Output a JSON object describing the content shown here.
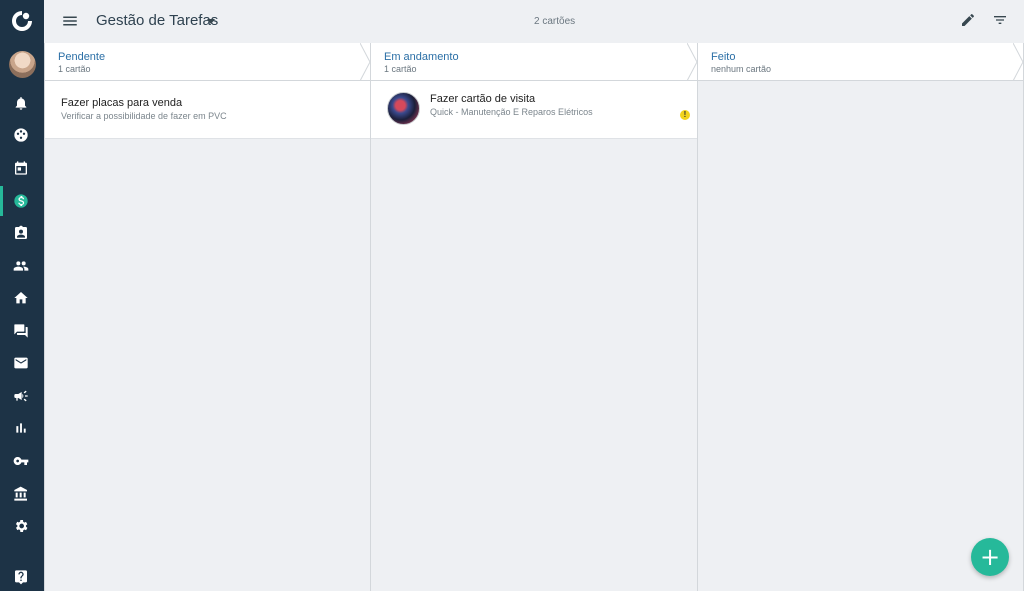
{
  "topbar": {
    "board_title": "Gestão de Tarefas",
    "cards_count": "2 cartões"
  },
  "sidebar": {
    "items": [
      {
        "icon": "bell-icon"
      },
      {
        "icon": "palette-icon"
      },
      {
        "icon": "calendar-icon"
      },
      {
        "icon": "dollar-icon",
        "active": true
      },
      {
        "icon": "contact-card-icon"
      },
      {
        "icon": "people-icon"
      },
      {
        "icon": "home-icon"
      },
      {
        "icon": "chat-icon"
      },
      {
        "icon": "mail-icon"
      },
      {
        "icon": "megaphone-icon"
      },
      {
        "icon": "bar-chart-icon"
      },
      {
        "icon": "key-icon"
      },
      {
        "icon": "bank-icon"
      },
      {
        "icon": "gear-icon"
      },
      {
        "icon": "help-icon"
      }
    ],
    "active_color": "#26b99a"
  },
  "columns": [
    {
      "name": "Pendente",
      "count": "1 cartão",
      "cards": [
        {
          "title": "Fazer placas para venda",
          "description": "Verificar a possibilidade de fazer em PVC"
        }
      ]
    },
    {
      "name": "Em andamento",
      "count": "1 cartão",
      "cards": [
        {
          "title": "Fazer cartão de visita",
          "description": "Quick - Manutenção E Reparos Elétricos",
          "warning": "!"
        }
      ]
    },
    {
      "name": "Feito",
      "count": "nenhum cartão",
      "cards": []
    }
  ],
  "fab": {
    "label": "+"
  },
  "colors": {
    "sidebar": "#1d3346",
    "accent": "#26b99a",
    "column_title": "#2b6fa6",
    "warning": "#f2d31b"
  }
}
